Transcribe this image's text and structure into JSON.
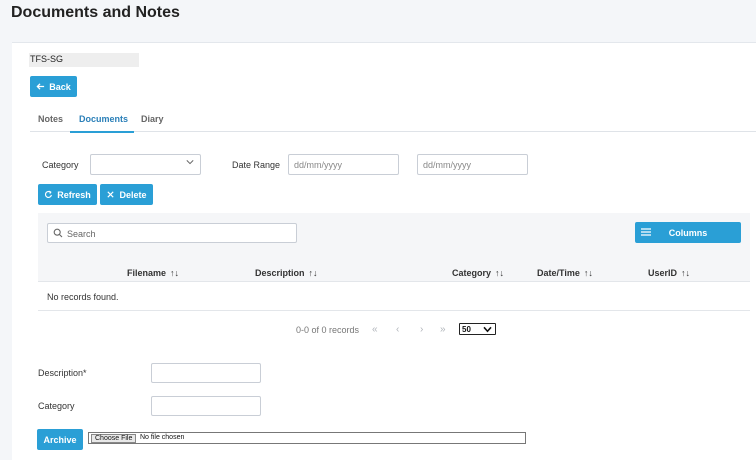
{
  "page": {
    "title": "Documents and Notes"
  },
  "record": {
    "ref": "TFS-SG"
  },
  "back_label": "Back",
  "tabs": [
    {
      "label": "Notes"
    },
    {
      "label": "Documents",
      "active": true
    },
    {
      "label": "Diary"
    }
  ],
  "filters": {
    "category_label": "Category",
    "category_value": "",
    "date_range_label": "Date Range",
    "date_from_placeholder": "dd/mm/yyyy",
    "date_to_placeholder": "dd/mm/yyyy"
  },
  "actions": {
    "refresh": "Refresh",
    "delete": "Delete"
  },
  "search": {
    "placeholder": "Search"
  },
  "columns_label": "Columns",
  "table": {
    "headers": [
      "Filename",
      "Description",
      "Category",
      "Date/Time",
      "UserID"
    ],
    "sort_glyph": "↑↓",
    "empty_message": "No records found."
  },
  "pagination": {
    "summary": "0-0 of 0 records",
    "per_page": "50"
  },
  "upload": {
    "description_label": "Description*",
    "category_label": "Category",
    "archive_label": "Archive",
    "choose_file_label": "Choose File",
    "no_file_label": "No file chosen"
  },
  "colors": {
    "accent": "#2a9fd6",
    "tab_active": "#2a7fb8"
  }
}
